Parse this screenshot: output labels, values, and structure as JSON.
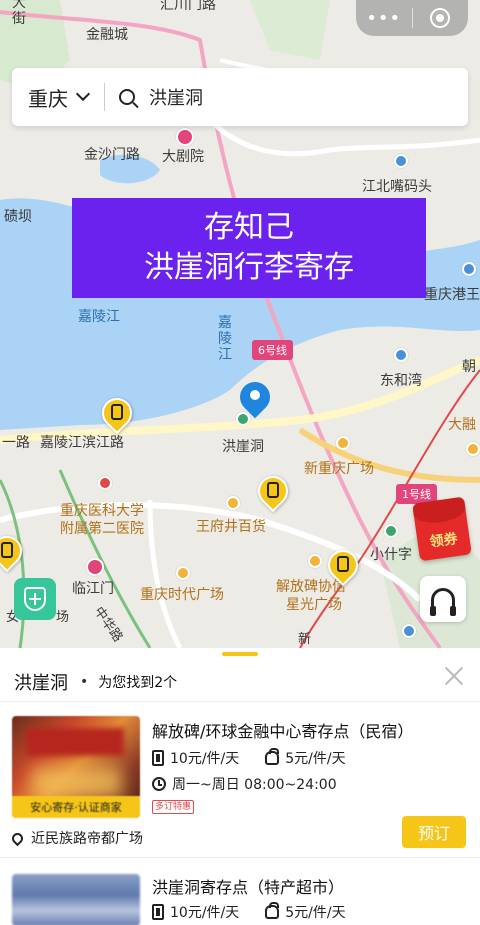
{
  "top_capsule": {
    "more_glyph": "•••",
    "target_label": ""
  },
  "search": {
    "city": "重庆",
    "query": "洪崖洞"
  },
  "banner": {
    "line1": "存知己",
    "line2": "洪崖洞行李寄存"
  },
  "map": {
    "labels": {
      "jinrongcheng": "金融城",
      "jinshamenlu": "金沙门路",
      "daju": "大剧院",
      "jiangbeizui": "江北嘴码头",
      "qiba": "碛坝",
      "jialingjiang1": "嘉陵江",
      "jialingjiang_v1": "嘉",
      "jialingjiang_v2": "陵",
      "jialingjiang_v3": "江",
      "chongqinggang": "重庆港王",
      "dongshuimen": "东和湾",
      "chao": "朝",
      "darong": "大融",
      "lu": "一路",
      "binjiang": "嘉陵江滨江路",
      "hongyadong": "洪崖洞",
      "xinchongqing": "新重庆广场",
      "hospital1": "重庆医科大学",
      "hospital2": "附属第二医院",
      "wangfujing": "王府井百货",
      "xiaoshizi": "小什字",
      "linjiangmen": "临江门",
      "shidai": "重庆时代广场",
      "jiefangbei1": "解放碑协信",
      "jiefangbei2": "星光广场",
      "women": "女",
      "chang": "场",
      "zhonghua": "中华路",
      "xin": "新",
      "top1": "街",
      "top2": "大",
      "top3": "汇川门路"
    },
    "line6": "6号线",
    "line1": "1号线",
    "coupon_text": "领券"
  },
  "results": {
    "keyword": "洪崖洞",
    "bullet": "•",
    "count_text": "为您找到2个",
    "items": [
      {
        "title": "解放碑/环球金融中心寄存点（民宿）",
        "price_suitcase": "10元/件/天",
        "price_bag": "5元/件/天",
        "hours": "周一~周日 08:00~24:00",
        "promo": "多订特惠",
        "badge": "安心寄存·认证商家",
        "address": "近民族路帝都广场",
        "book_label": "预订"
      },
      {
        "title": "洪崖洞寄存点（特产超市）",
        "price_suitcase": "10元/件/天",
        "price_bag": "5元/件/天"
      }
    ]
  }
}
